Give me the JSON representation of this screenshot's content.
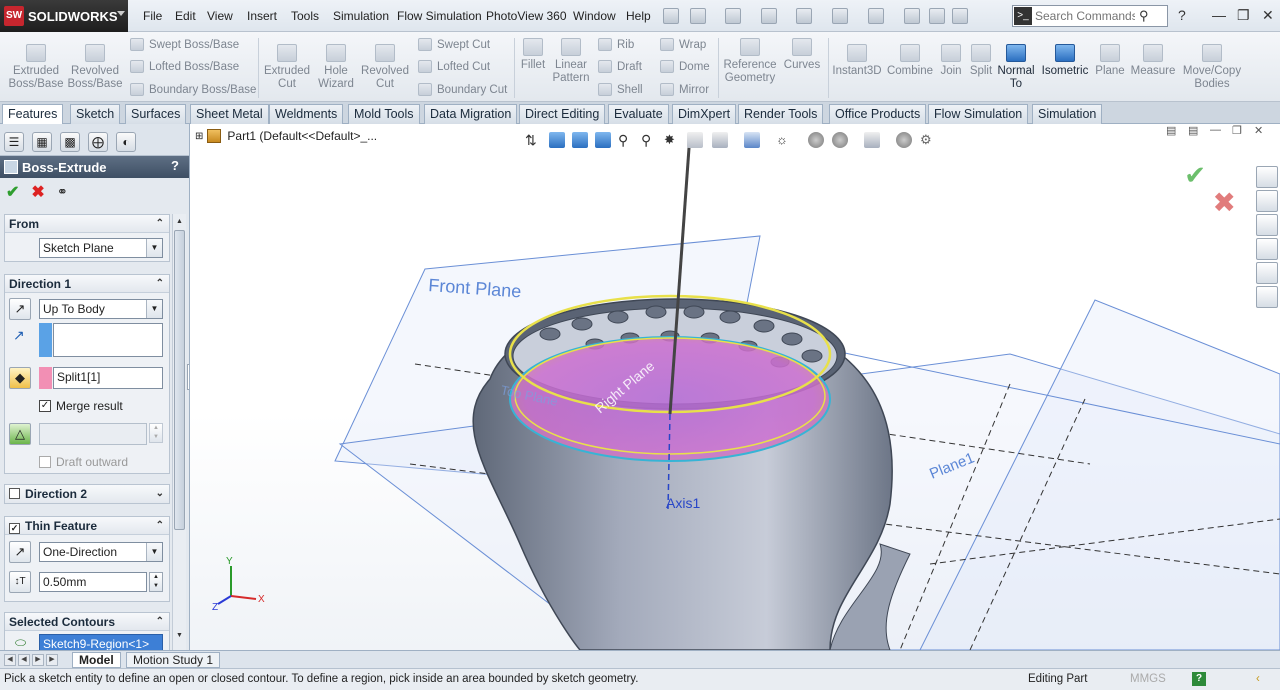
{
  "app": {
    "logo": "SOLIDWORKS",
    "logo_badge": "SW"
  },
  "menu": [
    "File",
    "Edit",
    "View",
    "Insert",
    "Tools",
    "Simulation",
    "Flow Simulation",
    "PhotoView 360",
    "Window",
    "Help"
  ],
  "search": {
    "placeholder": "Search Commands"
  },
  "commands": {
    "extruded_boss": "Extruded Boss/Base",
    "revolved_boss": "Revolved Boss/Base",
    "swept_boss": "Swept Boss/Base",
    "lofted_boss": "Lofted Boss/Base",
    "boundary_boss": "Boundary Boss/Base",
    "extruded_cut": "Extruded Cut",
    "hole_wizard": "Hole Wizard",
    "revolved_cut": "Revolved Cut",
    "swept_cut": "Swept Cut",
    "lofted_cut": "Lofted Cut",
    "boundary_cut": "Boundary Cut",
    "fillet": "Fillet",
    "linear_pattern": "Linear Pattern",
    "rib": "Rib",
    "draft": "Draft",
    "shell": "Shell",
    "wrap": "Wrap",
    "dome": "Dome",
    "mirror": "Mirror",
    "reference_geometry": "Reference Geometry",
    "curves": "Curves",
    "instant3d": "Instant3D",
    "combine": "Combine",
    "join": "Join",
    "split": "Split",
    "normal_to": "Normal To",
    "isometric": "Isometric",
    "plane": "Plane",
    "measure": "Measure",
    "move_copy": "Move/Copy Bodies"
  },
  "tabs": [
    "Features",
    "Sketch",
    "Surfaces",
    "Sheet Metal",
    "Weldments",
    "Mold Tools",
    "Data Migration",
    "Direct Editing",
    "Evaluate",
    "DimXpert",
    "Render Tools",
    "Office Products",
    "Flow Simulation",
    "Simulation"
  ],
  "property_manager": {
    "title": "Boss-Extrude",
    "help": "?",
    "from": {
      "label": "From",
      "value": "Sketch Plane"
    },
    "direction1": {
      "label": "Direction 1",
      "end_condition": "Up To Body",
      "face_value": "",
      "body_value": "Split1[1]",
      "merge_result": "Merge result",
      "draft_outward": "Draft outward"
    },
    "direction2": {
      "label": "Direction 2"
    },
    "thin_feature": {
      "label": "Thin Feature",
      "type": "One-Direction",
      "thickness": "0.50mm"
    },
    "selected_contours": {
      "label": "Selected Contours",
      "item": "Sketch9-Region<1>"
    }
  },
  "graphics": {
    "tree_label": "Part1  (Default<<Default>_...",
    "labels": {
      "front_plane": "Front Plane",
      "right_plane": "Right Plane",
      "plane1": "Plane1",
      "axis1": "Axis1",
      "top_plane": "Top Plane"
    },
    "triad": {
      "x": "X",
      "y": "Y",
      "z": "Z"
    }
  },
  "bottom_tabs": [
    "Model",
    "Motion Study 1"
  ],
  "status": {
    "message": "Pick a sketch entity to define an open or closed contour. To define a region, pick inside an area bounded by sketch geometry.",
    "mode": "Editing Part",
    "units": "MMGS",
    "help": "?"
  }
}
